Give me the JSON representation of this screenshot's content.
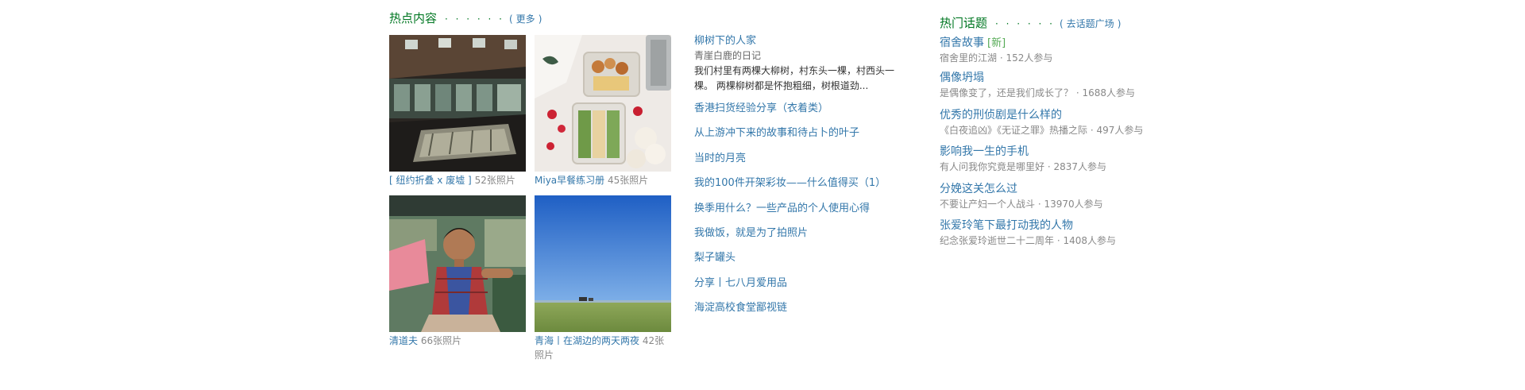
{
  "hot_content": {
    "title": "热点内容",
    "dots": "· · · · · ·",
    "paren_open": "(",
    "more_label": "更多",
    "paren_close": ")",
    "albums": [
      {
        "title": "[ 纽约折叠 x 废墟 ]",
        "count": "52张照片",
        "image": "abandoned-pool-hall"
      },
      {
        "title": "Miya早餐练习册",
        "count": "45张照片",
        "image": "breakfast-sandwiches"
      },
      {
        "title": "清道夫",
        "count": "66张照片",
        "image": "portrait-young-man"
      },
      {
        "title": "青海丨在湖边的两天两夜",
        "count": "42张照片",
        "image": "blue-sky-grassland"
      }
    ]
  },
  "hot_list": {
    "featured": {
      "title": "柳树下的人家",
      "source": "青崖白鹿的日记",
      "excerpt": "我们村里有两棵大柳树，村东头一棵，村西头一棵。 两棵柳树都是怀抱粗细，树根道劲..."
    },
    "items": [
      "香港扫货经验分享（衣着类）",
      "从上游冲下来的故事和待占卜的叶子",
      "当时的月亮",
      "我的100件开架彩妆——什么值得买（1）",
      "换季用什么？一些产品的个人使用心得",
      "我做饭，就是为了拍照片",
      "梨子罐头",
      "分享丨七八月爱用品",
      "海淀高校食堂鄙视链"
    ]
  },
  "hot_topics": {
    "title": "热门话题",
    "dots": "· · · · · ·",
    "paren_open": "(",
    "link_label": "去话题广场",
    "paren_close": ")",
    "topics": [
      {
        "name": "宿舍故事",
        "badge": "[新]",
        "meta": "宿舍里的江湖 · 152人参与"
      },
      {
        "name": "偶像坍塌",
        "badge": "",
        "meta": "是偶像变了，还是我们成长了？ · 1688人参与"
      },
      {
        "name": "优秀的刑侦剧是什么样的",
        "badge": "",
        "meta": "《白夜追凶》《无证之罪》热播之际 · 497人参与"
      },
      {
        "name": "影响我一生的手机",
        "badge": "",
        "meta": "有人问我你究竟是哪里好 · 2837人参与"
      },
      {
        "name": "分娩这关怎么过",
        "badge": "",
        "meta": "不要让产妇一个人战斗 · 13970人参与"
      },
      {
        "name": "张爱玲笔下最打动我的人物",
        "badge": "",
        "meta": "纪念张爱玲逝世二十二周年 · 1408人参与"
      }
    ]
  },
  "colors": {
    "section_title": "#007722",
    "link": "#3377aa",
    "muted": "#888888",
    "new_badge": "#55aa55"
  }
}
